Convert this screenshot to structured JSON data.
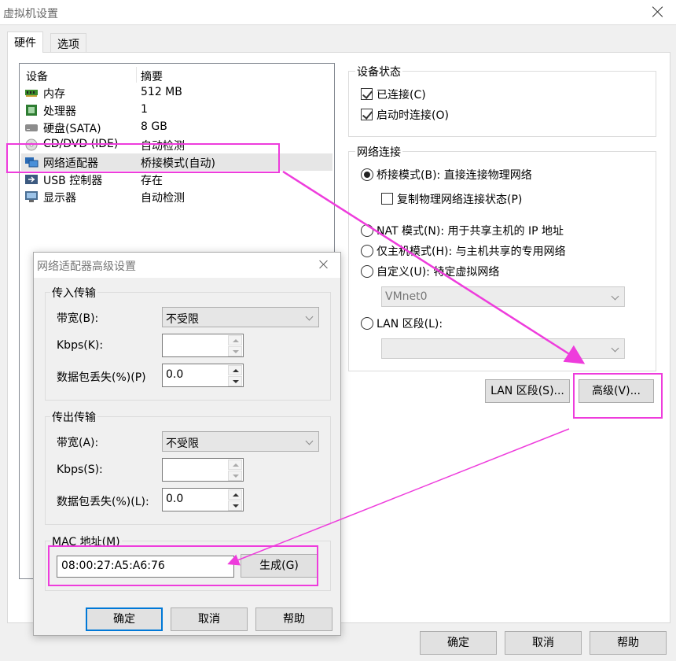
{
  "window": {
    "title": "虚拟机设置"
  },
  "tabs": [
    {
      "label": "硬件"
    },
    {
      "label": "选项"
    }
  ],
  "device_list": {
    "col_device": "设备",
    "col_summary": "摘要",
    "rows": [
      {
        "name": "内存",
        "summary": "512 MB",
        "icon": "memory-icon"
      },
      {
        "name": "处理器",
        "summary": "1",
        "icon": "processor-icon"
      },
      {
        "name": "硬盘(SATA)",
        "summary": "8 GB",
        "icon": "hard-disk-icon"
      },
      {
        "name": "CD/DVD (IDE)",
        "summary": "自动检测",
        "icon": "cd-dvd-icon"
      },
      {
        "name": "网络适配器",
        "summary": "桥接模式(自动)",
        "icon": "network-adapter-icon"
      },
      {
        "name": "USB 控制器",
        "summary": "存在",
        "icon": "usb-icon"
      },
      {
        "name": "显示器",
        "summary": "自动检测",
        "icon": "display-icon"
      }
    ]
  },
  "device_status": {
    "title": "设备状态",
    "connected": "已连接(C)",
    "connect_on_start": "启动时连接(O)"
  },
  "network": {
    "title": "网络连接",
    "bridged": "桥接模式(B): 直接连接物理网络",
    "replicate": "复制物理网络连接状态(P)",
    "nat": "NAT 模式(N): 用于共享主机的 IP 地址",
    "host_only": "仅主机模式(H): 与主机共享的专用网络",
    "custom": "自定义(U): 特定虚拟网络",
    "custom_value": "VMnet0",
    "lan": "LAN 区段(L):",
    "lan_segments_button": "LAN 区段(S)...",
    "advanced_button": "高级(V)..."
  },
  "footer": {
    "ok": "确定",
    "cancel": "取消",
    "help": "帮助"
  },
  "advanced_dialog": {
    "title": "网络适配器高级设置",
    "incoming": {
      "title": "传入传输",
      "bandwidth_label": "带宽(B):",
      "bandwidth_value": "不受限",
      "kbps_label": "Kbps(K):",
      "kbps_value": "",
      "loss_label": "数据包丢失(%)(P)",
      "loss_value": "0.0"
    },
    "outgoing": {
      "title": "传出传输",
      "bandwidth_label": "带宽(A):",
      "bandwidth_value": "不受限",
      "kbps_label": "Kbps(S):",
      "kbps_value": "",
      "loss_label": "数据包丢失(%)(L):",
      "loss_value": "0.0"
    },
    "mac": {
      "title": "MAC 地址(M)",
      "value": "08:00:27:A5:A6:76",
      "generate_button": "生成(G)"
    },
    "ok": "确定",
    "cancel": "取消",
    "help": "帮助"
  },
  "colors": {
    "highlight": "#ee3cdc",
    "default_button_border": "#0078d7"
  }
}
